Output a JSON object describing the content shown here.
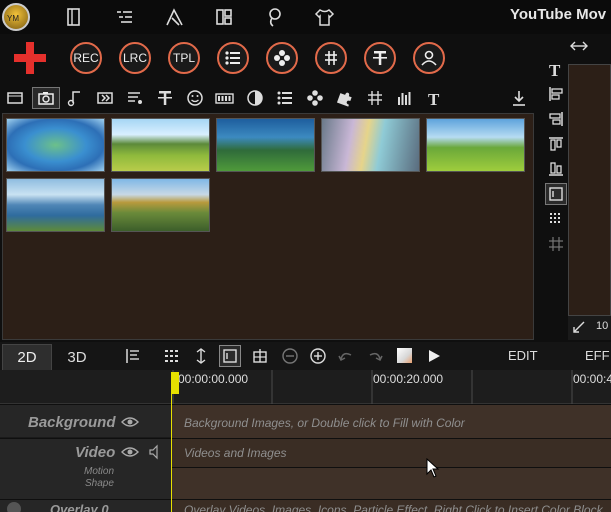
{
  "app": {
    "title": "YouTube Mov"
  },
  "top_nav": [
    {
      "icon": "logo"
    },
    {
      "icon": "book-icon"
    },
    {
      "icon": "list-icon"
    },
    {
      "icon": "vector-icon"
    },
    {
      "icon": "layout-icon"
    },
    {
      "icon": "lasso-icon"
    },
    {
      "icon": "shirt-icon"
    }
  ],
  "main_toolbar": {
    "add": "+",
    "rec": "REC",
    "lrc": "LRC",
    "tpl": "TPL"
  },
  "media": {
    "thumbnails": [
      {
        "name": "earth-clouds"
      },
      {
        "name": "mountain-road"
      },
      {
        "name": "green-valley"
      },
      {
        "name": "rainbow-sea"
      },
      {
        "name": "green-field"
      },
      {
        "name": "lake-hills"
      },
      {
        "name": "palace-garden"
      }
    ]
  },
  "preview": {
    "zoom_label": "10"
  },
  "timeline": {
    "tab_2d": "2D",
    "tab_3d": "3D",
    "edit_label": "EDIT",
    "eff_label": "EFF",
    "times": [
      "00:00:00.000",
      "00:00:20.000",
      "00:00:4"
    ],
    "tracks": {
      "background": {
        "label": "Background",
        "hint": "Background Images, or Double click to Fill with Color"
      },
      "video": {
        "label": "Video",
        "sub1": "Motion",
        "sub2": "Shape",
        "hint": "Videos and Images"
      },
      "overlay": {
        "label": "Overlay 0",
        "hint": "Overlay Videos, Images, Icons, Particle Effect. Right Click to Insert Color Block"
      }
    }
  },
  "colors": {
    "accent": "#e26a4a",
    "panel": "#2c1f17",
    "playhead": "#e6e000"
  }
}
